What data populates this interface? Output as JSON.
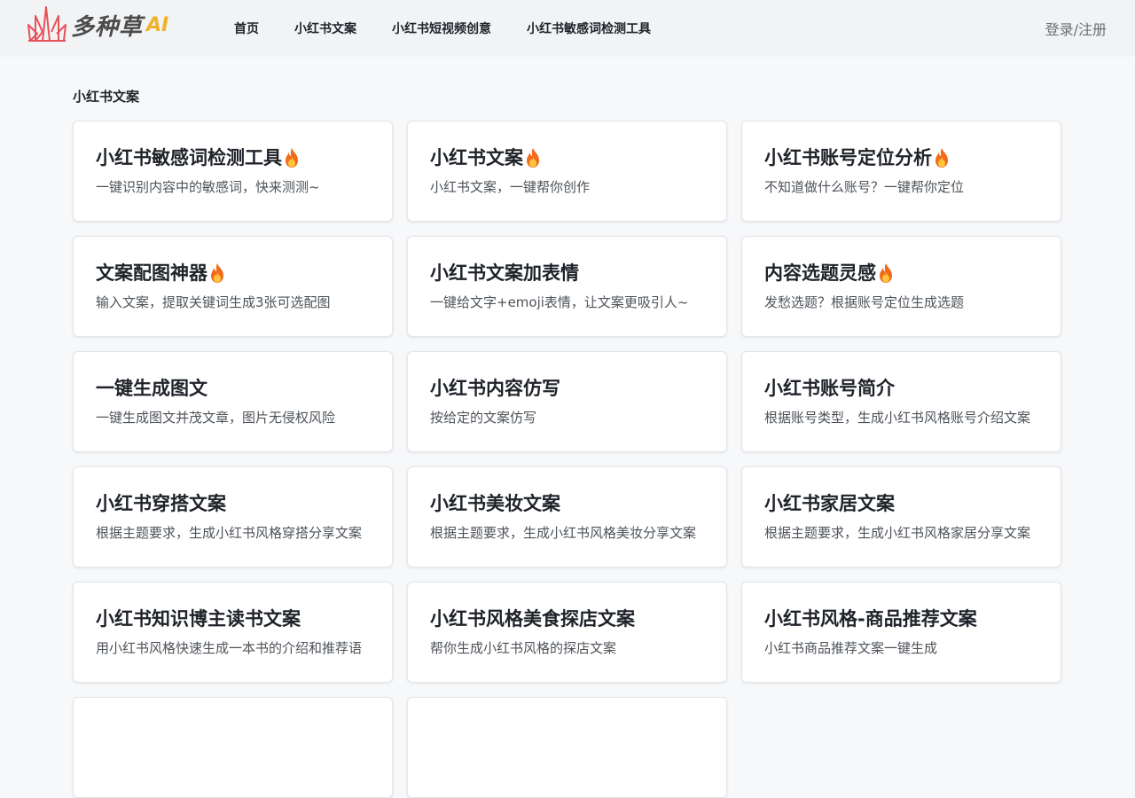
{
  "header": {
    "logo_text": "多种草",
    "logo_ai": "AI",
    "nav": [
      {
        "label": "首页"
      },
      {
        "label": "小红书文案"
      },
      {
        "label": "小红书短视频创意"
      },
      {
        "label": "小红书敏感词检测工具"
      }
    ],
    "login_label": "登录/注册"
  },
  "section": {
    "title": "小红书文案"
  },
  "cards": [
    {
      "title": "小红书敏感词检测工具",
      "desc": "一键识别内容中的敏感词，快来测测~",
      "icon": "fire-icon",
      "hot": true
    },
    {
      "title": "小红书文案",
      "desc": "小红书文案，一键帮你创作",
      "icon": "fire-icon",
      "hot": true
    },
    {
      "title": "小红书账号定位分析",
      "desc": "不知道做什么账号？一键帮你定位",
      "icon": "fire-icon",
      "hot": true
    },
    {
      "title": "文案配图神器",
      "desc": "输入文案，提取关键词生成3张可选配图",
      "icon": "fire-icon",
      "hot": true
    },
    {
      "title": "小红书文案加表情",
      "desc": "一键给文字+emoji表情，让文案更吸引人~",
      "hot": false
    },
    {
      "title": "内容选题灵感",
      "desc": "发愁选题？根据账号定位生成选题",
      "icon": "fire-icon",
      "hot": true
    },
    {
      "title": "一键生成图文",
      "desc": "一键生成图文并茂文章，图片无侵权风险",
      "hot": false
    },
    {
      "title": "小红书内容仿写",
      "desc": "按给定的文案仿写",
      "hot": false
    },
    {
      "title": "小红书账号简介",
      "desc": "根据账号类型，生成小红书风格账号介绍文案",
      "hot": false
    },
    {
      "title": "小红书穿搭文案",
      "desc": "根据主题要求，生成小红书风格穿搭分享文案",
      "hot": false
    },
    {
      "title": "小红书美妆文案",
      "desc": "根据主题要求，生成小红书风格美妆分享文案",
      "hot": false
    },
    {
      "title": "小红书家居文案",
      "desc": "根据主题要求，生成小红书风格家居分享文案",
      "hot": false
    },
    {
      "title": "小红书知识博主读书文案",
      "desc": "用小红书风格快速生成一本书的介绍和推荐语",
      "hot": false
    },
    {
      "title": "小红书风格美食探店文案",
      "desc": "帮你生成小红书风格的探店文案",
      "hot": false
    },
    {
      "title": "小红书风格-商品推荐文案",
      "desc": "小红书商品推荐文案一键生成",
      "hot": false
    },
    {
      "title": "",
      "desc": "",
      "hot": false
    },
    {
      "title": "",
      "desc": "",
      "hot": false
    }
  ],
  "colors": {
    "background": "#f7f8fa",
    "header_bg": "#f2f3f5",
    "logo_red": "#e8505b",
    "logo_ai": "#f0b22a",
    "fire_orange": "#f26a1b"
  }
}
